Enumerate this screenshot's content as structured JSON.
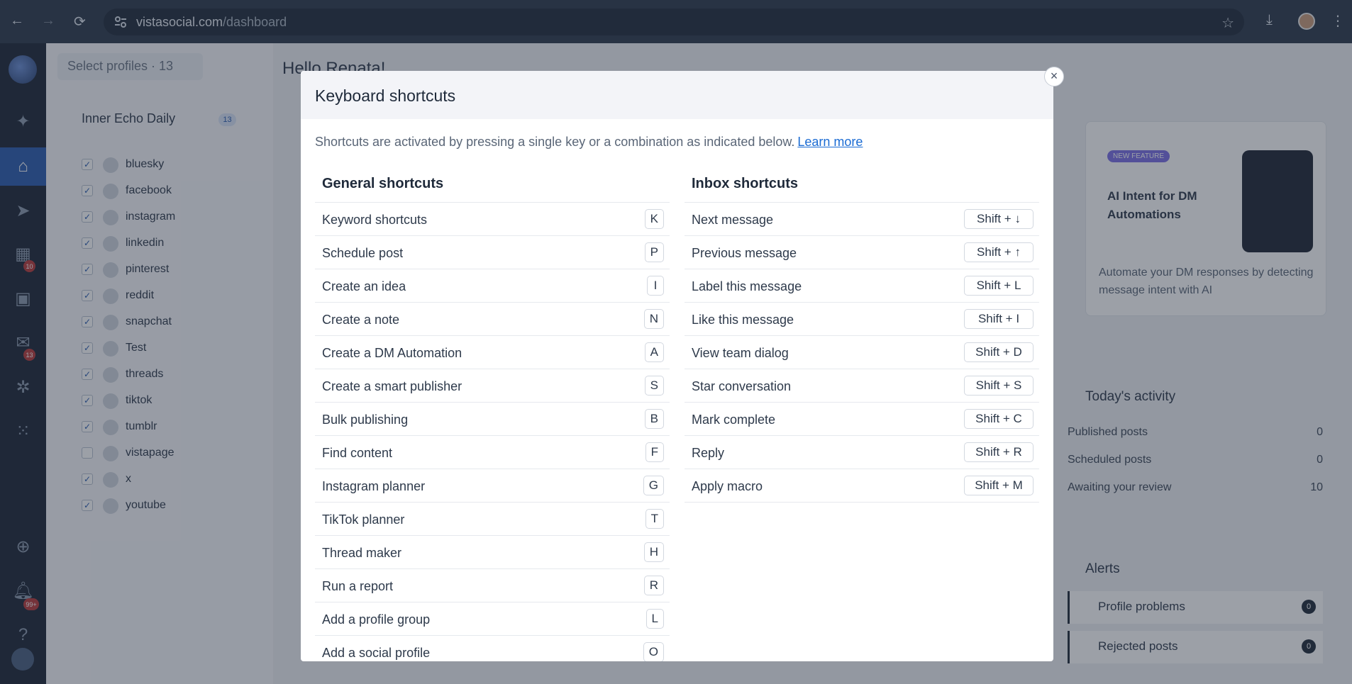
{
  "browser": {
    "url_domain": "vistasocial.com",
    "url_path": "/dashboard"
  },
  "rail": {
    "badges": {
      "calendar": "10",
      "inbox": "13",
      "notifications": "99+"
    }
  },
  "sidebar": {
    "select_profiles": "Select profiles · 13",
    "group_name": "Inner Echo Daily",
    "group_count": "13",
    "profiles": [
      {
        "label": "bluesky",
        "checked": "✓"
      },
      {
        "label": "facebook",
        "checked": "✓"
      },
      {
        "label": "instagram",
        "checked": "✓"
      },
      {
        "label": "linkedin",
        "checked": "✓"
      },
      {
        "label": "pinterest",
        "checked": "✓"
      },
      {
        "label": "reddit",
        "checked": "✓"
      },
      {
        "label": "snapchat",
        "checked": "✓"
      },
      {
        "label": "Test",
        "checked": "✓"
      },
      {
        "label": "threads",
        "checked": "✓"
      },
      {
        "label": "tiktok",
        "checked": "✓"
      },
      {
        "label": "tumblr",
        "checked": "✓"
      },
      {
        "label": "vistapage",
        "checked": ""
      },
      {
        "label": "x",
        "checked": "✓"
      },
      {
        "label": "youtube",
        "checked": "✓"
      }
    ]
  },
  "main": {
    "greeting": "Hello Renata!",
    "feature_card": {
      "badge": "NEW FEATURE",
      "title": "AI Intent for DM Automations",
      "description": "Automate your DM responses by detecting message intent with AI"
    },
    "activity": {
      "title": "Today's activity",
      "rows": [
        {
          "label": "Published posts",
          "value": "0"
        },
        {
          "label": "Scheduled posts",
          "value": "0"
        },
        {
          "label": "Awaiting your review",
          "value": "10"
        }
      ]
    },
    "alerts": {
      "title": "Alerts",
      "rows": [
        {
          "label": "Profile problems",
          "count": "0"
        },
        {
          "label": "Rejected posts",
          "count": "0"
        }
      ]
    }
  },
  "modal": {
    "title": "Keyboard shortcuts",
    "close_label": "×",
    "intro_text": "Shortcuts are activated by pressing a single key or a combination as indicated below.",
    "learn_more": "Learn more",
    "general": {
      "heading": "General shortcuts",
      "items": [
        {
          "name": "Keyword shortcuts",
          "key": "K"
        },
        {
          "name": "Schedule post",
          "key": "P"
        },
        {
          "name": "Create an idea",
          "key": "I"
        },
        {
          "name": "Create a note",
          "key": "N"
        },
        {
          "name": "Create a DM Automation",
          "key": "A"
        },
        {
          "name": "Create a smart publisher",
          "key": "S"
        },
        {
          "name": "Bulk publishing",
          "key": "B"
        },
        {
          "name": "Find content",
          "key": "F"
        },
        {
          "name": "Instagram planner",
          "key": "G"
        },
        {
          "name": "TikTok planner",
          "key": "T"
        },
        {
          "name": "Thread maker",
          "key": "H"
        },
        {
          "name": "Run a report",
          "key": "R"
        },
        {
          "name": "Add a profile group",
          "key": "L"
        },
        {
          "name": "Add a social profile",
          "key": "O"
        }
      ]
    },
    "inbox": {
      "heading": "Inbox shortcuts",
      "items": [
        {
          "name": "Next message",
          "key": "Shift + ↓"
        },
        {
          "name": "Previous message",
          "key": "Shift + ↑"
        },
        {
          "name": "Label this message",
          "key": "Shift + L"
        },
        {
          "name": "Like this message",
          "key": "Shift + I"
        },
        {
          "name": "View team dialog",
          "key": "Shift + D"
        },
        {
          "name": "Star conversation",
          "key": "Shift + S"
        },
        {
          "name": "Mark complete",
          "key": "Shift + C"
        },
        {
          "name": "Reply",
          "key": "Shift + R"
        },
        {
          "name": "Apply macro",
          "key": "Shift + M"
        }
      ]
    }
  }
}
